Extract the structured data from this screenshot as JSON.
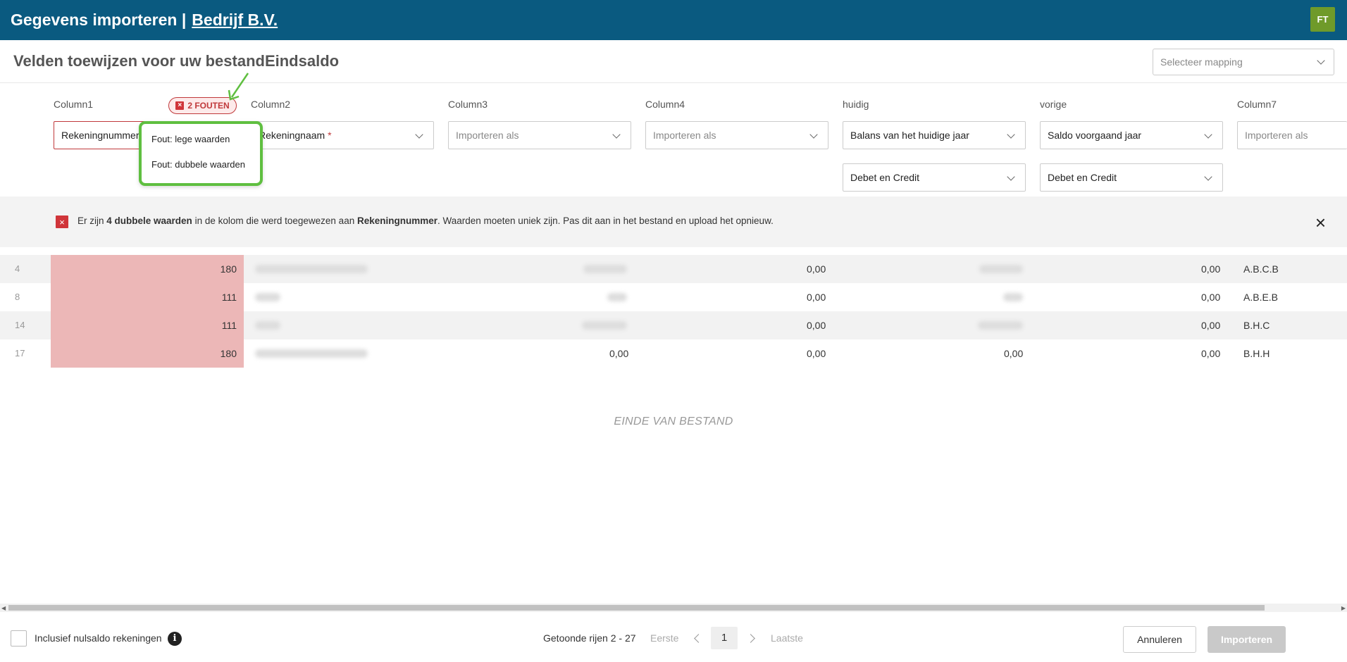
{
  "header": {
    "title": "Gegevens importeren |",
    "company": "Bedrijf B.V.",
    "avatar": "FT"
  },
  "page": {
    "title": "Velden toewijzen voor uw bestandEindsaldo",
    "mapping_placeholder": "Selecteer mapping"
  },
  "columns": [
    {
      "header": "Column1",
      "value": "Rekeningnummer",
      "required": "*"
    },
    {
      "header": "Column2",
      "value": "Rekeningnaam",
      "required": "*"
    },
    {
      "header": "Column3",
      "value": "Importeren als"
    },
    {
      "header": "Column4",
      "value": "Importeren als"
    },
    {
      "header": "huidig",
      "value": "Balans van het huidige jaar",
      "sub": "Debet en Credit"
    },
    {
      "header": "vorige",
      "value": "Saldo voorgaand jaar",
      "sub": "Debet en Credit"
    },
    {
      "header": "Column7",
      "value": "Importeren als"
    }
  ],
  "errors": {
    "badge": "2 FOUTEN",
    "items": [
      "Fout: lege waarden",
      "Fout: dubbele waarden"
    ]
  },
  "banner": {
    "pre": "Er zijn ",
    "count": "4 dubbele waarden",
    "mid": " in de kolom die werd toegewezen aan ",
    "column": "Rekeningnummer",
    "post": ". Waarden moeten uniek zijn. Pas dit aan in het bestand en upload het opnieuw."
  },
  "rows": [
    {
      "num": "4",
      "key": "180",
      "c4": "0,00",
      "c6": "0,00",
      "c7": "A.B.C.B"
    },
    {
      "num": "8",
      "key": "111",
      "c4": "0,00",
      "c6": "0,00",
      "c7": "A.B.E.B"
    },
    {
      "num": "14",
      "key": "111",
      "c4": "0,00",
      "c6": "0,00",
      "c7": "B.H.C"
    },
    {
      "num": "17",
      "key": "180",
      "c3": "0,00",
      "c4": "0,00",
      "c5": "0,00",
      "c6": "0,00",
      "c7": "B.H.H"
    }
  ],
  "eof": "EINDE VAN BESTAND",
  "footer": {
    "checkbox_label": "Inclusief nulsaldo rekeningen",
    "info": "i",
    "rows_shown": "Getoonde rijen 2 - 27",
    "first": "Eerste",
    "page": "1",
    "last": "Laatste",
    "cancel": "Annuleren",
    "import": "Importeren"
  },
  "icons": {
    "close": "×",
    "error": "×"
  },
  "colors": {
    "header": "#0a5a80",
    "avatar": "#6f9a2a",
    "error": "#c0393b",
    "highlight": "#ecb7b7",
    "callout": "#5fbf40"
  }
}
